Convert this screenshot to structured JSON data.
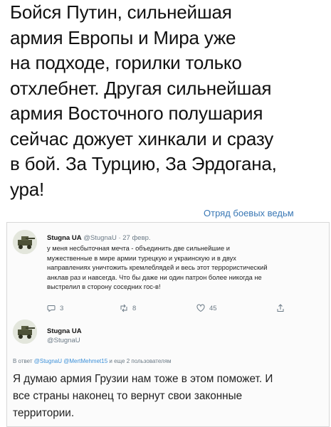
{
  "headline": {
    "lines": [
      "Бойся Путин, сильнейшая",
      "армия Европы и Мира уже",
      "на подходе, горилки только",
      "отхлебнет. Другая сильнейшая",
      "армия Восточного полушария",
      "сейчас дожует хинкали и сразу",
      "в бой. За Турцию, За Эрдогана,",
      "ура!"
    ]
  },
  "watermark": "Отряд боевых ведьм",
  "tweet1": {
    "name": "Stugna UA",
    "handle": "@StugnaU",
    "date": "· 27 февр.",
    "lines": [
      "у меня несбыточная мечта - объединить две сильнейшие и",
      "мужественные в мире армии турецкую и украинскую и в двух",
      "направлениях уничтожить кремлеблядей и весь этот террористический",
      "анклав раз и навсегда. Что бы даже ни один патрон более никогда не",
      "выстрелил в сторону соседних гос-в!"
    ],
    "replies": "3",
    "retweets": "8",
    "likes": "45",
    "avatar_icon": "military-vehicle-avatar-icon"
  },
  "tweet2": {
    "name": "Stugna UA",
    "handle": "@StugnaU",
    "reply_prefix": "В ответ",
    "reply_links": "@StugnaU @MertMehmet15",
    "reply_suffix": "и еще 2 пользователям",
    "lines": [
      "Я думаю армия Грузии нам тоже в этом поможет. И",
      "все страны наконец то вернут свои законные",
      "территории."
    ],
    "avatar_icon": "military-vehicle-avatar-icon"
  },
  "colors": {
    "link": "#3a8fd8",
    "watermark": "#3a78b5",
    "muted": "#6b7a86"
  }
}
